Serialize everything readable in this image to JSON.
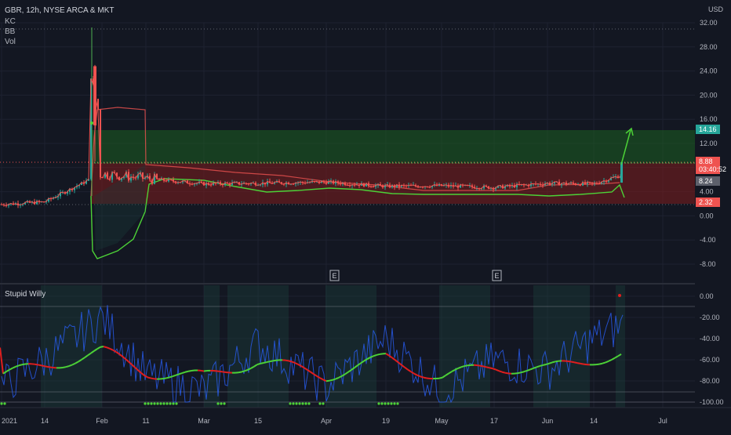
{
  "header": {
    "symbol_title": "GBR, 12h, NYSE ARCA & MKT",
    "currency": "USD",
    "indicators": [
      "KC",
      "BB",
      "Vol"
    ]
  },
  "colors": {
    "background": "#131722",
    "grid": "#1e2230",
    "axis_text": "#b2b5be",
    "candle_up": "#26a69a",
    "candle_down": "#ef5350",
    "bb_upper": "#ef5350",
    "kc_lower": "#4caf50",
    "green_zone": "#1b5e20",
    "red_zone": "#7f1d1d",
    "stupid_willy_line": "#2962ff",
    "signal_green": "#4cd137",
    "signal_red": "#e01e1e",
    "highlight_band": "#1b3b3a",
    "arrow": "#4cd137"
  },
  "price_axis": {
    "ticks": [
      "32.00",
      "28.00",
      "24.00",
      "20.00",
      "16.00",
      "12.00",
      "8.00",
      "4.00",
      "0.00",
      "-4.00",
      "-8.00"
    ],
    "tags": [
      {
        "label": "14.16",
        "color": "#26a69a"
      },
      {
        "label": "8.88",
        "color": "#ef5350"
      },
      {
        "label": "03:40:52",
        "color": "#ef5350"
      },
      {
        "label": "8.24",
        "color": "#5d606b"
      },
      {
        "label": "2.32",
        "color": "#ef5350"
      }
    ]
  },
  "oscillator": {
    "title": "Stupid Willy",
    "ticks": [
      "0.00",
      "-20.00",
      "-40.00",
      "-60.00",
      "-80.00",
      "-100.00"
    ]
  },
  "time_axis": {
    "labels": [
      "2021",
      "14",
      "Feb",
      "11",
      "Mar",
      "15",
      "Apr",
      "19",
      "May",
      "17",
      "Jun",
      "14",
      "Jul"
    ]
  },
  "earnings_markers": [
    "E",
    "E"
  ],
  "chart_data": [
    {
      "type": "line",
      "title": "GBR, 12h, NYSE ARCA & MKT",
      "yunit": "USD",
      "ylim": [
        -10,
        33
      ],
      "x": [
        "2021",
        "14",
        "Feb",
        "11",
        "Mar",
        "15",
        "Apr",
        "19",
        "May",
        "17",
        "Jun",
        "14",
        "Jul"
      ],
      "series": [
        {
          "values": [
            1.9,
            2.3,
            7.0,
            6.2,
            5.3,
            5.4,
            5.6,
            4.9,
            5.0,
            4.7,
            5.4,
            5.3,
            8.9
          ]
        }
      ],
      "levels": [
        14.16,
        8.88,
        8.24,
        2.32
      ],
      "grid": true,
      "legend": "top-left"
    },
    {
      "type": "line",
      "title": "Stupid Willy",
      "ylim": [
        -105,
        5
      ],
      "x": [
        "2021",
        "14",
        "Feb",
        "11",
        "Mar",
        "15",
        "Apr",
        "19",
        "May",
        "17",
        "Jun",
        "14",
        "Jul"
      ],
      "series": [
        {
          "values": [
            -85,
            -60,
            -20,
            -75,
            -90,
            -45,
            -85,
            -40,
            -90,
            -60,
            -70,
            -40,
            -10
          ]
        }
      ],
      "grid": true
    }
  ]
}
